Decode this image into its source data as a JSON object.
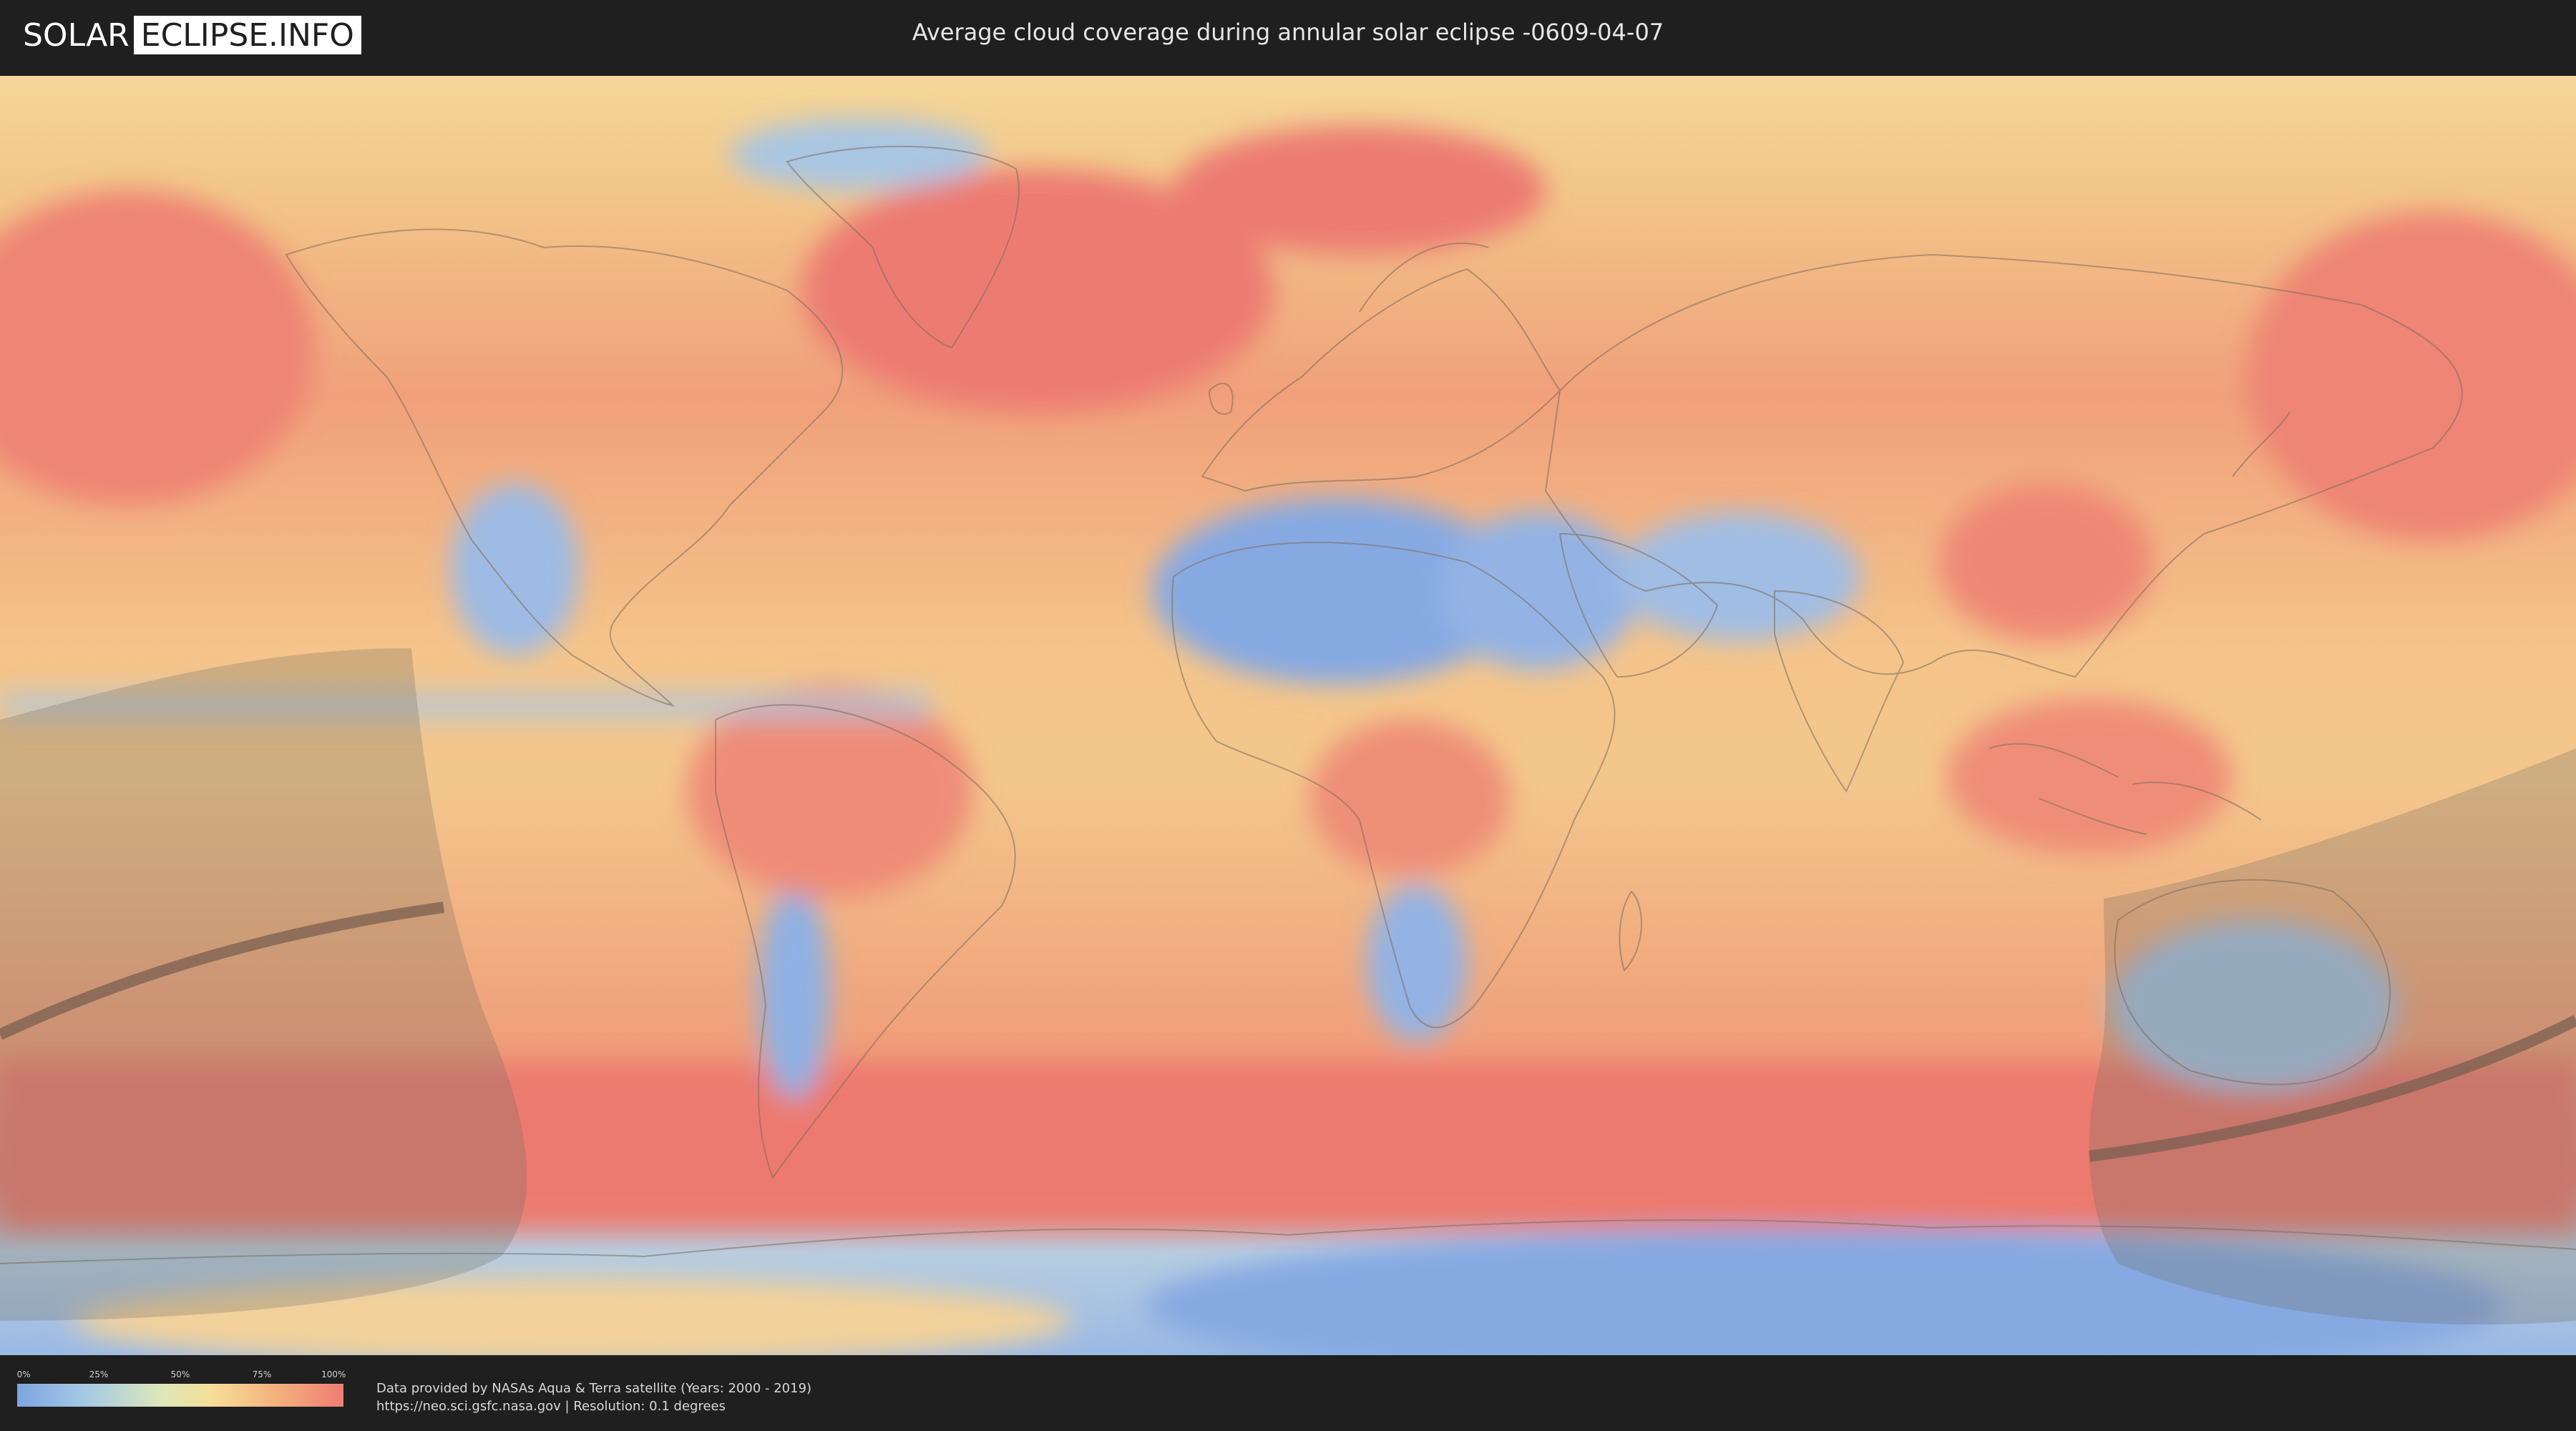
{
  "header": {
    "logo": {
      "solar": "SOLAR",
      "eclipse": "ECLIPSE.INFO"
    },
    "title": "Average cloud coverage during annular solar eclipse -0609-04-07"
  },
  "legend": {
    "ticks": [
      "0%",
      "25%",
      "50%",
      "75%",
      "100%"
    ],
    "colors": [
      "#7ea4e0",
      "#a8cbe4",
      "#dfe8b8",
      "#f6dd98",
      "#f4b07c",
      "#ee7d72"
    ]
  },
  "footer": {
    "line1": "Data provided by NASAs Aqua & Terra satellite (Years: 2000 - 2019)",
    "line2": "https://neo.sci.gsfc.nasa.gov | Resolution: 0.1 degrees"
  },
  "map": {
    "ocean_base": "#f2b07a",
    "high_cloud": "#ee7f74",
    "low_cloud": "#86a9e2",
    "shadow_overlay": "#6e6a60"
  }
}
